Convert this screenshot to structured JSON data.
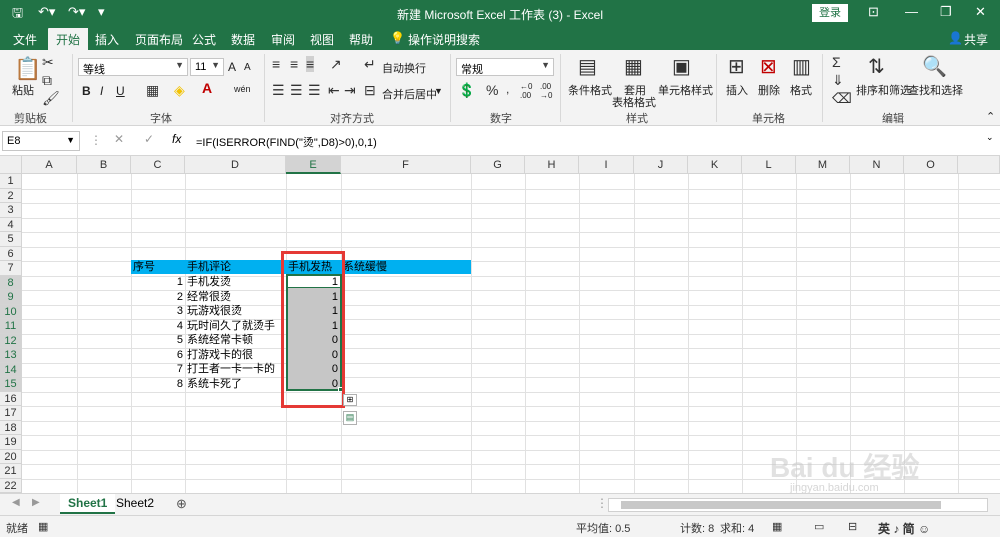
{
  "window": {
    "title": "新建 Microsoft Excel 工作表 (3)  -  Excel",
    "login_label": "登录",
    "share_label": "共享"
  },
  "tabs": [
    "文件",
    "开始",
    "插入",
    "页面布局",
    "公式",
    "数据",
    "审阅",
    "视图",
    "帮助"
  ],
  "tell_me": "操作说明搜索",
  "ribbon": {
    "clipboard": {
      "paste": "粘贴",
      "group": "剪贴板"
    },
    "font": {
      "name": "等线",
      "size": "11",
      "group": "字体",
      "grow": "A",
      "shrink": "A",
      "bold": "B",
      "italic": "I",
      "underline": "U",
      "wen": "wén"
    },
    "alignment": {
      "wrap": "自动换行",
      "merge": "合并后居中",
      "group": "对齐方式"
    },
    "number": {
      "format": "常规",
      "group": "数字"
    },
    "styles": {
      "cond": "条件格式",
      "table": "套用",
      "table2": "表格格式",
      "cell": "单元格样式",
      "group": "样式"
    },
    "cells": {
      "insert": "插入",
      "delete": "删除",
      "format": "格式",
      "group": "单元格"
    },
    "editing": {
      "sort": "排序和筛选",
      "find": "查找和选择",
      "group": "编辑"
    }
  },
  "formula_bar": {
    "name_box": "E8",
    "formula": "=IF(ISERROR(FIND(\"烫\",D8)>0),0,1)",
    "fx": "fx"
  },
  "columns": [
    "A",
    "B",
    "C",
    "D",
    "E",
    "F",
    "G",
    "H",
    "I",
    "J",
    "K",
    "L",
    "M",
    "N",
    "O"
  ],
  "rows": [
    "1",
    "2",
    "3",
    "4",
    "5",
    "6",
    "7",
    "8",
    "9",
    "10",
    "11",
    "12",
    "13",
    "14",
    "15",
    "16",
    "17",
    "18",
    "19",
    "20",
    "21",
    "22"
  ],
  "table": {
    "headers": [
      "序号",
      "手机评论",
      "手机发热",
      "系统缓慢"
    ],
    "rows": [
      {
        "no": "1",
        "comment": "手机发烫",
        "heat": "1"
      },
      {
        "no": "2",
        "comment": "经常很烫",
        "heat": "1"
      },
      {
        "no": "3",
        "comment": "玩游戏很烫",
        "heat": "1"
      },
      {
        "no": "4",
        "comment": "玩时间久了就烫手",
        "heat": "1"
      },
      {
        "no": "5",
        "comment": "系统经常卡顿",
        "heat": "0"
      },
      {
        "no": "6",
        "comment": "打游戏卡的很",
        "heat": "0"
      },
      {
        "no": "7",
        "comment": "打王者一卡一卡的",
        "heat": "0"
      },
      {
        "no": "8",
        "comment": "系统卡死了",
        "heat": "0"
      }
    ]
  },
  "sheets": [
    "Sheet1",
    "Sheet2"
  ],
  "status": {
    "mode": "就绪",
    "average": "平均值: 0.5",
    "count": "计数: 8",
    "sum": "求和: 4"
  },
  "watermark": "Bai du 经验",
  "watermark_url": "jingyan.baidu.com",
  "ime": "英 ♪ 简 ☺",
  "colors": {
    "accent": "#217346",
    "header_fill": "#00b0f0",
    "highlight_box": "#e53935",
    "selection_fill": "#c6c6c6"
  }
}
